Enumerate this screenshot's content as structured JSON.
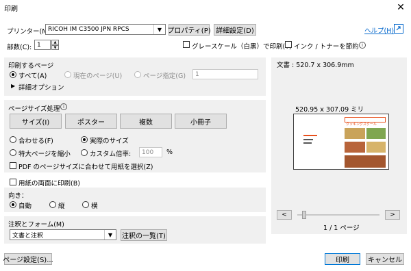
{
  "window": {
    "title": "印刷",
    "close_glyph": "✕"
  },
  "top": {
    "printer_label": "プリンター(N):",
    "printer_value": "RICOH IM C3500 JPN RPCS",
    "properties_button": "プロパティ(P)",
    "advanced_button": "詳細設定(D)",
    "help_link": "ヘルプ(H)",
    "help_icon": "help-icon",
    "copies_label": "部数(C):",
    "copies_value": "1",
    "grayscale_label": "グレースケール（白黒）で印刷(Y)",
    "save_ink_label": "インク / トナーを節約"
  },
  "pages": {
    "title": "印刷するページ",
    "all_label": "すべて(A)",
    "current_label": "現在のページ(U)",
    "specify_label": "ページ指定(G)",
    "specify_value": "1",
    "more_options_label": "詳細オプション"
  },
  "sizing": {
    "title": "ページサイズ処理",
    "buttons": [
      "サイズ(I)",
      "ポスター",
      "複数",
      "小冊子"
    ],
    "fit_label": "合わせる(F)",
    "actual_label": "実際のサイズ",
    "shrink_label": "特大ページを縮小",
    "custom_label": "カスタム倍率:",
    "custom_value": "100",
    "percent": "%",
    "pdf_paper_label": "PDF のページサイズに合わせて用紙を選択(Z)"
  },
  "duplex": {
    "label": "用紙の両面に印刷(B)"
  },
  "orientation": {
    "title": "向き：",
    "auto_label": "自動",
    "portrait_label": "縦",
    "landscape_label": "横"
  },
  "comments": {
    "title": "注釈とフォーム(M)",
    "value": "文書と注釈",
    "summary_button": "注釈の一覧(T)"
  },
  "preview": {
    "doc_label": "文書 : 520.7 x 306.9mm",
    "size_label": "520.95 x 307.09 ミリ",
    "prev_glyph": "<",
    "next_glyph": ">",
    "page_label": "1 / 1 ページ",
    "thumb_brand": "クッキングスクール"
  },
  "footer": {
    "page_setup_button": "ページ設定(S)...",
    "print_button": "印刷",
    "cancel_button": "キャンセル"
  },
  "colors": {
    "panel": "#f0f0f0",
    "button": "#e1e1e1",
    "link": "#0066cc",
    "focus": "#0078d7",
    "thumb_accent": "#e8501c"
  }
}
